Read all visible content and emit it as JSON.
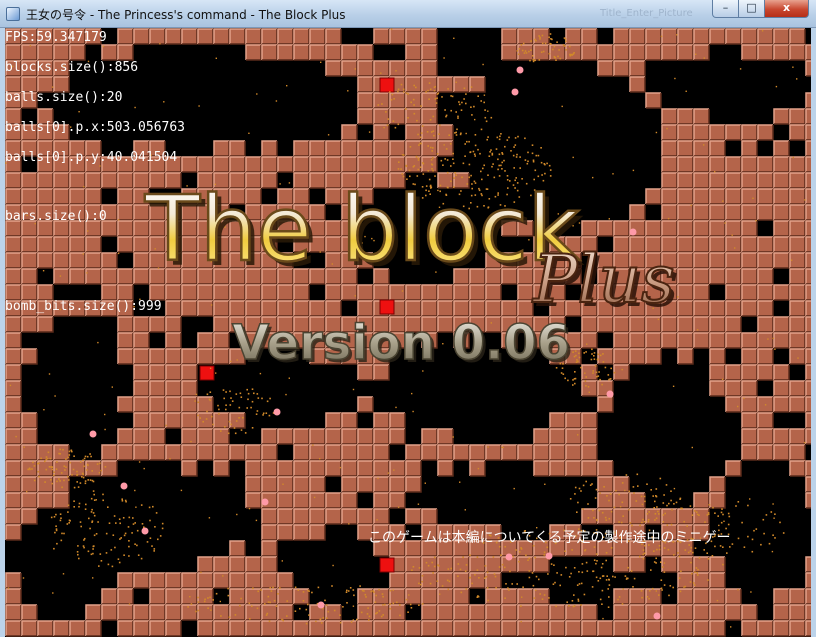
{
  "window": {
    "title": "王女の号令 - The Princess's command - The Block Plus",
    "ghost_title": "Title_Enter_Picture",
    "minimize": "–",
    "maximize": "□",
    "close": "x"
  },
  "debug": {
    "fps": "FPS:59.347179",
    "blocks": "blocks.size():856",
    "balls": "balls.size():20",
    "ball_px": "balls[0].p.x:503.056763",
    "ball_py": "balls[0].p.y:40.041504",
    "bars": "bars.size():0",
    "bomb_bits": "bomb_bits.size():999"
  },
  "logo": {
    "main": "The block",
    "plus": "Plus",
    "version": "Version 0.06"
  },
  "message": "このゲームは本編についてくる予定の製作途中のミニゲー",
  "colors": {
    "brick": "#b4644a",
    "brick_light": "#e4a28a",
    "brick_dark": "#5a2a1a",
    "special_block": "#ee1010",
    "ball": "#ff9aa8",
    "particle": "#d28a2a",
    "background": "#000000"
  }
}
